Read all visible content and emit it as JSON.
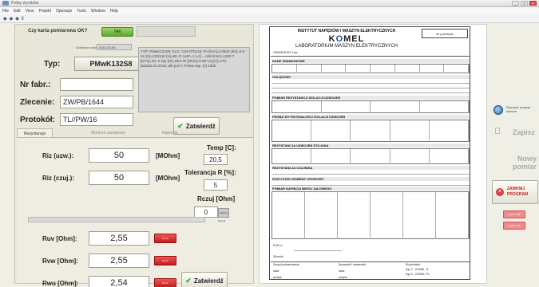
{
  "window": {
    "title": "Próby wyrobów",
    "min": "_",
    "max": "□",
    "close": "×"
  },
  "menu": [
    "File",
    "Edit",
    "View",
    "Projekt",
    "Operacje",
    "Tools",
    "Window",
    "Help"
  ],
  "toolbar": [
    "◆",
    "◆",
    "◆",
    "Ⅱ"
  ],
  "check": {
    "label": "Czy karta pomiarowa OK?",
    "button": "TAK"
  },
  "form": {
    "date_label": "Dzisiejsza data",
    "date_value": "2010-02-06",
    "typ_label": "Typ:",
    "typ_value": "PMwK132S8",
    "nr_label": "Nr fabr.:",
    "nr_value": "",
    "zlecenie_label": "Zlecenie:",
    "zlecenie_value": "ZW/PB/1644",
    "protokol_label": "Protokół:",
    "protokol_value": "TL//PW/16",
    "info_text": "TYP: PMwK132S8; KLG: C04-070219; Pn [kVA]=2.8kVA [kV]=0.8 Un [V]=220/110 [V]=80, R cosF=1 [=1] = Izdc/mm2=1302 T [N*m]=20, S Spr [%]=99.5 IE [Ohm]=0.68 Uzj [V]=275; Data02.02.2016; akt pol V; Próba nap. [V] 1500",
    "zatwierdz": "Zatwierdź"
  },
  "tabs": [
    "Rezystancje",
    "Moment zaciepowy",
    "Napięcie"
  ],
  "meas": {
    "riz_uzw_label": "Riz (uzw.):",
    "riz_uzw_value": "50",
    "riz_uzw_unit": "[MOhm]",
    "riz_czuj_label": "Riz (czuj.):",
    "riz_czuj_value": "50",
    "riz_czuj_unit": "[MOhm]",
    "temp_label": "Temp [C]:",
    "temp_value": "20,5",
    "tol_label": "Tolerancja R [%]:",
    "tol_value": "5",
    "rczuj_label": "Rczuj [Ohm]",
    "rczuj_value": "0",
    "pomiar_label": "Pomiar",
    "pomiar_btn": "Odczyt",
    "ruv_label": "Ruv [Ohm]:",
    "ruv_value": "2,55",
    "rvw_label": "Rvw [Ohm]:",
    "rvw_value": "2,55",
    "rwu_label": "Rwu [Ohm]:",
    "rwu_value": "2,54",
    "ind_text": "BŁĄD",
    "zatwierdz": "Zatwierdź"
  },
  "doc": {
    "title1": "INSTYTUT NAPĘDÓW I MASZYN ELEKTRYCZNYCH",
    "logo_k": "K",
    "logo_o": "O",
    "logo_rest": "MEL",
    "title2": "LABORATORIUM MASZYN ELEKTRYCZNYCH",
    "np_label": "Nr protokołu",
    "generator_label": "GENERATOR 3-faz",
    "dane": "DANE ZNAMIONOWE",
    "ogledziny": "OGLĘDZINY",
    "pomiar_rez": "POMIAR REZYSTANCJI IZOLACJI UZWOJEŃ",
    "proba_wytrz": "PRÓBA WYTRZYMAŁOŚCI IZOLACJI UZWOJEŃ",
    "rezystancja": "REZYSTANCJA UZWOJEŃ STOJANA",
    "rez_czujnika": "REZYSTANCJA CZUJNIKA",
    "statyczny": "STATYCZNY MOMENT OPOROWY",
    "pomiar_nap": "POMIAR NAPIĘCIA BIEGU JAŁOWEGO",
    "kod_label": "KOD nr",
    "uwagi_label": "Zbiornik",
    "foot_left": "Zespół potwierdzenie",
    "foot_mid": "Sprawdził i zatwierdził",
    "foot_right1": "Rozdzielnik:",
    "foot_right2": "Egz 1 - KOMEL TL",
    "foot_right3": "Egz 2 - KOMEL PV",
    "data_label": "data:",
    "podpis_label": "podpis:"
  },
  "right": {
    "koncowka": "Wyczyść pozycje obecne",
    "zapisz": "Zapisz",
    "nowy": "Nowy pomiar",
    "zamknij1": "ZAMKNIJ",
    "zamknij2": "PROGRAM",
    "mini1": "Zapisz PDF",
    "mini2": "Zapisz XLS"
  }
}
